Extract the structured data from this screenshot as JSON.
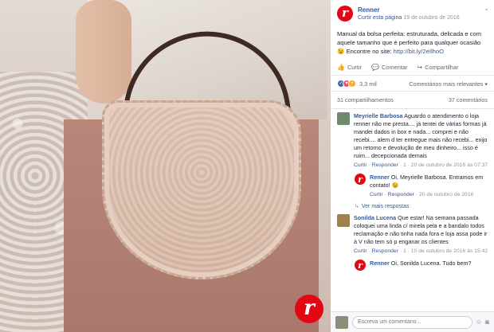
{
  "post": {
    "page_name": "Renner",
    "curtir_page": "Curtir esta página",
    "date": "19 de outubro de 2016",
    "text": "Manual da bolsa perfeita: estruturada, delicada e com aquele tamanho que é perfeito para qualquer ocasião 😉 Encontre no site: ",
    "link": "http://bit.ly/2eIlhoO",
    "avatar_letter": "r"
  },
  "actions": {
    "like": "Curtir",
    "comment": "Comentar",
    "share": "Compartilhar"
  },
  "reactions": {
    "count": "3,3 mil",
    "sort": "Comentários mais relevantes ▾"
  },
  "counts": {
    "shares": "31 compartilhamentos",
    "comments": "37 comentários"
  },
  "comments": [
    {
      "name": "Meyrielle Barbosa",
      "text": "Aguardo o atendimento o loja renner não me presta.... já tentei de várias formas já mandei dados in box e nada... comprei e não recebi.... alem d ter entregue mais não recebi... exijo um retorno e devolução de meu dinheiro... isso é ruim... decepcionada demais",
      "like": "Curtir",
      "reply": "Responder",
      "meta": "1 · 20 de outubro de 2016 às 07:37"
    },
    {
      "name": "Renner",
      "text": "Oi, Meyrielle Barbosa. Entramos em contato! 😉",
      "like": "Curtir",
      "reply": "Responder",
      "meta": "20 de outubro de 2016"
    }
  ],
  "more_replies": "Ver mais respostas",
  "comment2": {
    "name": "Sonilda Lucena",
    "text": "Que estar! Na semana passada coloquei uma linda c/ mirela pela e a bandalo todos reclamação e não tinha nada fora e loja assa pode ir à V não tem só p enganar os clientes",
    "like": "Curtir",
    "reply": "Responder",
    "meta": "1 · 10 de outubro de 2016 às 15:42"
  },
  "reply2": {
    "name": "Renner",
    "text": "Oi, Sonilda Lucena. Tudo bem?"
  },
  "composer": {
    "placeholder": "Escreva um comentário..."
  },
  "logo_letter": "r",
  "colors": {
    "brand": "#e30613",
    "link": "#365899",
    "muted": "#90949c"
  }
}
